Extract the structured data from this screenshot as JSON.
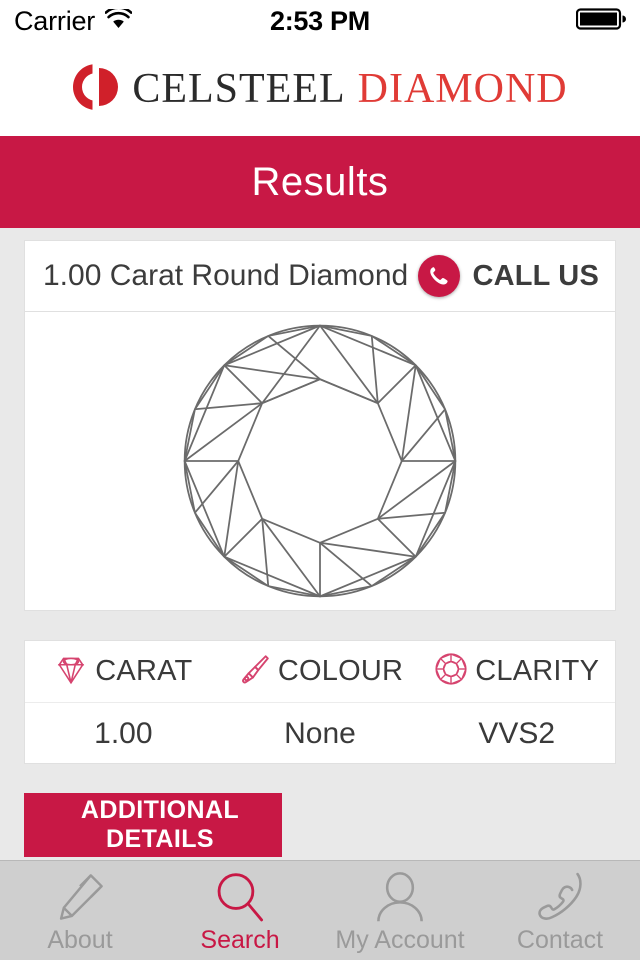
{
  "status_bar": {
    "carrier": "Carrier",
    "wifi_icon": "wifi-icon",
    "time": "2:53 PM",
    "battery_icon": "battery-full-icon"
  },
  "brand": {
    "logo_icon": "cd-monogram-logo",
    "name_primary": "CELSTEEL",
    "name_secondary": "DIAMOND"
  },
  "header": {
    "title": "Results"
  },
  "result": {
    "title": "1.00 Carat Round Diamond",
    "call_us": {
      "label": "CALL US",
      "icon": "phone-icon"
    },
    "image_icon": "round-brilliant-diamond-diagram",
    "attributes": [
      {
        "icon": "diamond-gem-icon",
        "label": "CARAT",
        "value": "1.00"
      },
      {
        "icon": "paintbrush-icon",
        "label": "COLOUR",
        "value": "None"
      },
      {
        "icon": "round-diamond-icon",
        "label": "CLARITY",
        "value": "VVS2"
      }
    ],
    "additional_details_label": "ADDITIONAL DETAILS"
  },
  "tabs": [
    {
      "label": "About",
      "icon": "pencil-icon",
      "active": false
    },
    {
      "label": "Search",
      "icon": "magnifier-icon",
      "active": true
    },
    {
      "label": "My Account",
      "icon": "person-icon",
      "active": false
    },
    {
      "label": "Contact",
      "icon": "phone-handset-icon",
      "active": false
    }
  ],
  "colors": {
    "brand_red": "#c81845",
    "brand_logo_red": "#e03b36",
    "page_background": "#e9e9e9",
    "tabbar_background": "#cfcfcf",
    "inactive_tab": "#9a9a9a"
  }
}
